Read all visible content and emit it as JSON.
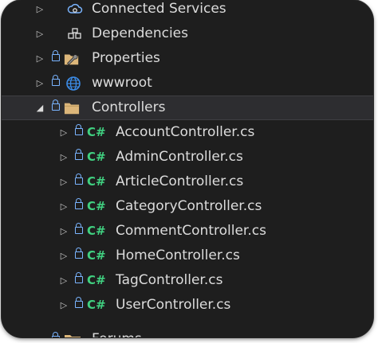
{
  "tree": {
    "items": [
      {
        "label": "Connected Services",
        "icon": "connected-services-icon"
      },
      {
        "label": "Dependencies",
        "icon": "dependencies-icon"
      },
      {
        "label": "Properties",
        "icon": "properties-icon"
      },
      {
        "label": "wwwroot",
        "icon": "globe-icon"
      },
      {
        "label": "Controllers",
        "icon": "folder-icon",
        "expanded": true
      },
      {
        "label": "AccountController.cs",
        "icon": "csharp-icon"
      },
      {
        "label": "AdminController.cs",
        "icon": "csharp-icon"
      },
      {
        "label": "ArticleController.cs",
        "icon": "csharp-icon"
      },
      {
        "label": "CategoryController.cs",
        "icon": "csharp-icon"
      },
      {
        "label": "CommentController.cs",
        "icon": "csharp-icon"
      },
      {
        "label": "HomeController.cs",
        "icon": "csharp-icon"
      },
      {
        "label": "TagController.cs",
        "icon": "csharp-icon"
      },
      {
        "label": "UserController.cs",
        "icon": "csharp-icon"
      }
    ],
    "csharp_glyph": "C#",
    "partial_label": "Forums"
  },
  "colors": {
    "background": "#1e1e1e",
    "text": "#dcdcdc",
    "lock": "#7ab4ff",
    "csharp": "#40d080",
    "folder": "#dcb67a",
    "globe": "#3c8ce7"
  }
}
